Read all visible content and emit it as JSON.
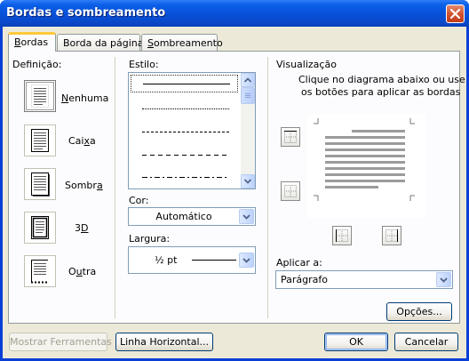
{
  "window": {
    "title": "Bordas e sombreamento"
  },
  "tabs": [
    {
      "label": "Bordas",
      "key": "B",
      "rest": "ordas",
      "active": true
    },
    {
      "label": "Borda da página",
      "key": "",
      "rest": "Borda da página",
      "active": false
    },
    {
      "label": "Sombreamento",
      "key": "S",
      "rest": "ombreamento",
      "active": false
    }
  ],
  "definition": {
    "label": "Definição:",
    "presets": [
      {
        "label": "Nenhuma",
        "pre": "",
        "key": "N",
        "post": "enhuma",
        "selected": true
      },
      {
        "label": "Caixa",
        "pre": "Cai",
        "key": "x",
        "post": "a",
        "selected": false
      },
      {
        "label": "Sombra",
        "pre": "Sombr",
        "key": "a",
        "post": "",
        "selected": false
      },
      {
        "label": "3D",
        "pre": "3",
        "key": "D",
        "post": "",
        "selected": false
      },
      {
        "label": "Outra",
        "pre": "O",
        "key": "u",
        "post": "tra",
        "selected": false
      }
    ]
  },
  "style": {
    "label": "Estilo:",
    "options": [
      "solid-thin",
      "dotted",
      "dashed-small",
      "dashed-medium",
      "dash-dot"
    ],
    "selected": 0
  },
  "color": {
    "label": "Cor:",
    "value": "Automático"
  },
  "width": {
    "label": "Largura:",
    "value": "½ pt"
  },
  "preview": {
    "label": "Visualização",
    "instruction_line1": "Clique no diagrama abaixo ou use",
    "instruction_line2": "os botões para aplicar as bordas"
  },
  "apply_to": {
    "label": "Aplicar a:",
    "value": "Parágrafo"
  },
  "buttons": {
    "options": "Opções...",
    "show_toolbar": "Mostrar Ferramentas",
    "horizontal_line": "Linha Horizontal...",
    "ok": "OK",
    "cancel": "Cancelar"
  },
  "colors": {
    "title_bar": "#0a48c8",
    "dialog_bg": "#ece9d8",
    "tab_highlight": "#ffc83c",
    "xp_red_close": "#d24f2c"
  }
}
